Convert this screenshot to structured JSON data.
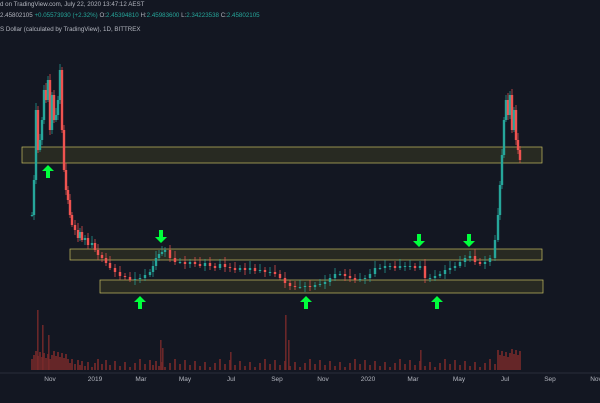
{
  "header": {
    "published": "d on TradingView.com, July 22, 2020 13:47:12 AEST",
    "ohlc_prefix": "2.45802105",
    "change": "+0.05573930 (+2.32%)",
    "o_label": "O:",
    "o_value": "2.45394810",
    "h_label": "H:",
    "h_value": "2.45983600",
    "l_label": "L:",
    "l_value": "2.34223538",
    "c_label": "C:",
    "c_value": "2.45802105",
    "symbol_desc": "S Dollar (calculated by TradingView), 1D, BITTREX"
  },
  "colors": {
    "background": "#131722",
    "up": "#26a69a",
    "down": "#ef5350",
    "arrow": "#00ff3c",
    "zone_fill": "#3a3a22",
    "zone_stroke": "#c8c060",
    "volume": "#7a2a2a"
  },
  "chart_data": {
    "type": "candlestick",
    "x_tick_labels": [
      "Nov",
      "2019",
      "Mar",
      "May",
      "Jul",
      "Sep",
      "Nov",
      "2020",
      "Mar",
      "May",
      "Jul",
      "Sep",
      "Nov"
    ],
    "zones": [
      {
        "label": "upper-resistance-zone"
      },
      {
        "label": "middle-zone"
      },
      {
        "label": "lower-support-zone"
      }
    ],
    "arrows": [
      {
        "direction": "up"
      },
      {
        "direction": "down"
      },
      {
        "direction": "up"
      },
      {
        "direction": "up"
      },
      {
        "direction": "down"
      },
      {
        "direction": "down"
      },
      {
        "direction": "up"
      }
    ]
  }
}
